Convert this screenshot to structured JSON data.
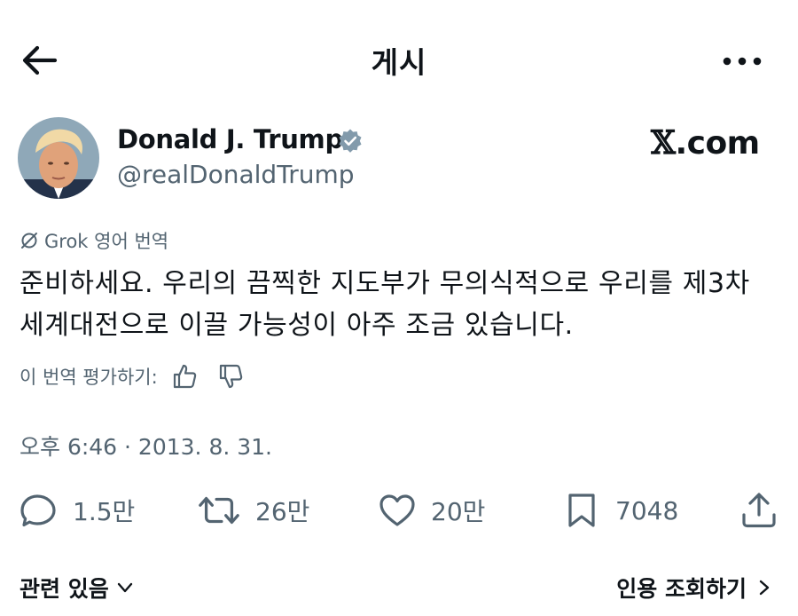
{
  "header": {
    "title": "게시",
    "back_icon": "arrow-left-icon",
    "more_icon": "more-horizontal-icon"
  },
  "author": {
    "name": "Donald J. Trump",
    "handle": "@realDonaldTrump",
    "verified_color": "#829aab",
    "site_logo_mark": "𝕏",
    "site_logo_text": ".com"
  },
  "translation": {
    "label": "Grok 영어 번역",
    "rate_label": "이 번역 평가하기:"
  },
  "tweet": {
    "text": "준비하세요. 우리의 끔찍한 지도부가 무의식적으로 우리를 제3차 세계대전으로 이끌 가능성이 아주 조금 있습니다.",
    "timestamp": "오후 6:46 · 2013. 8. 31."
  },
  "actions": {
    "replies": "1.5만",
    "reposts": "26만",
    "likes": "20만",
    "bookmarks": "7048"
  },
  "footer": {
    "related": "관련 있음",
    "quotes": "인용 조회하기"
  },
  "colors": {
    "text": "#0f1419",
    "secondary": "#536471"
  }
}
